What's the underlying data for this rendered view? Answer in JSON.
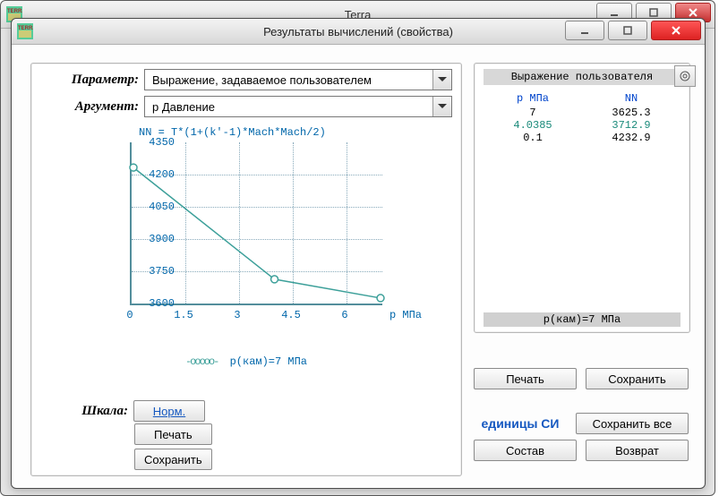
{
  "outer": {
    "title": "Terra"
  },
  "inner": {
    "title": "Результаты вычислений (свойства)"
  },
  "params": {
    "param_label": "Параметр:",
    "arg_label": "Аргумент:",
    "param_value": "Выражение, задаваемое пользователем",
    "arg_value": "p  Давление"
  },
  "scale": {
    "label": "Шкала:",
    "norm": "Норм.",
    "print": "Печать",
    "save": "Сохранить"
  },
  "right_table": {
    "title": "Выражение пользователя",
    "col1": "p МПа",
    "col2": "NN",
    "rows": [
      {
        "c1": "7",
        "c2": "3625.3",
        "hl": false
      },
      {
        "c1": "4.0385",
        "c2": "3712.9",
        "hl": true
      },
      {
        "c1": "0.1",
        "c2": "4232.9",
        "hl": false
      }
    ],
    "footer": "p(кам)=7 МПа"
  },
  "right_buttons": {
    "print": "Печать",
    "save": "Сохранить",
    "si": "единицы СИ",
    "save_all": "Сохранить все",
    "compose": "Состав",
    "return": "Возврат"
  },
  "chart_data": {
    "type": "line",
    "title": "NN = T*(1+(k'-1)*Mach*Mach/2)",
    "xlabel": "p МПа",
    "ylabel": "",
    "xlim": [
      0,
      7
    ],
    "ylim": [
      3600,
      4350
    ],
    "xticks": [
      0,
      1.5,
      3,
      4.5,
      6
    ],
    "yticks": [
      3600,
      3750,
      3900,
      4050,
      4200,
      4350
    ],
    "series": [
      {
        "name": "p(кам)=7 МПа",
        "x": [
          0.1,
          4.0385,
          7
        ],
        "y": [
          4232.9,
          3712.9,
          3625.3
        ]
      }
    ],
    "legend_marker": "-ooooo-",
    "legend_text": "p(кам)=7 МПа"
  }
}
